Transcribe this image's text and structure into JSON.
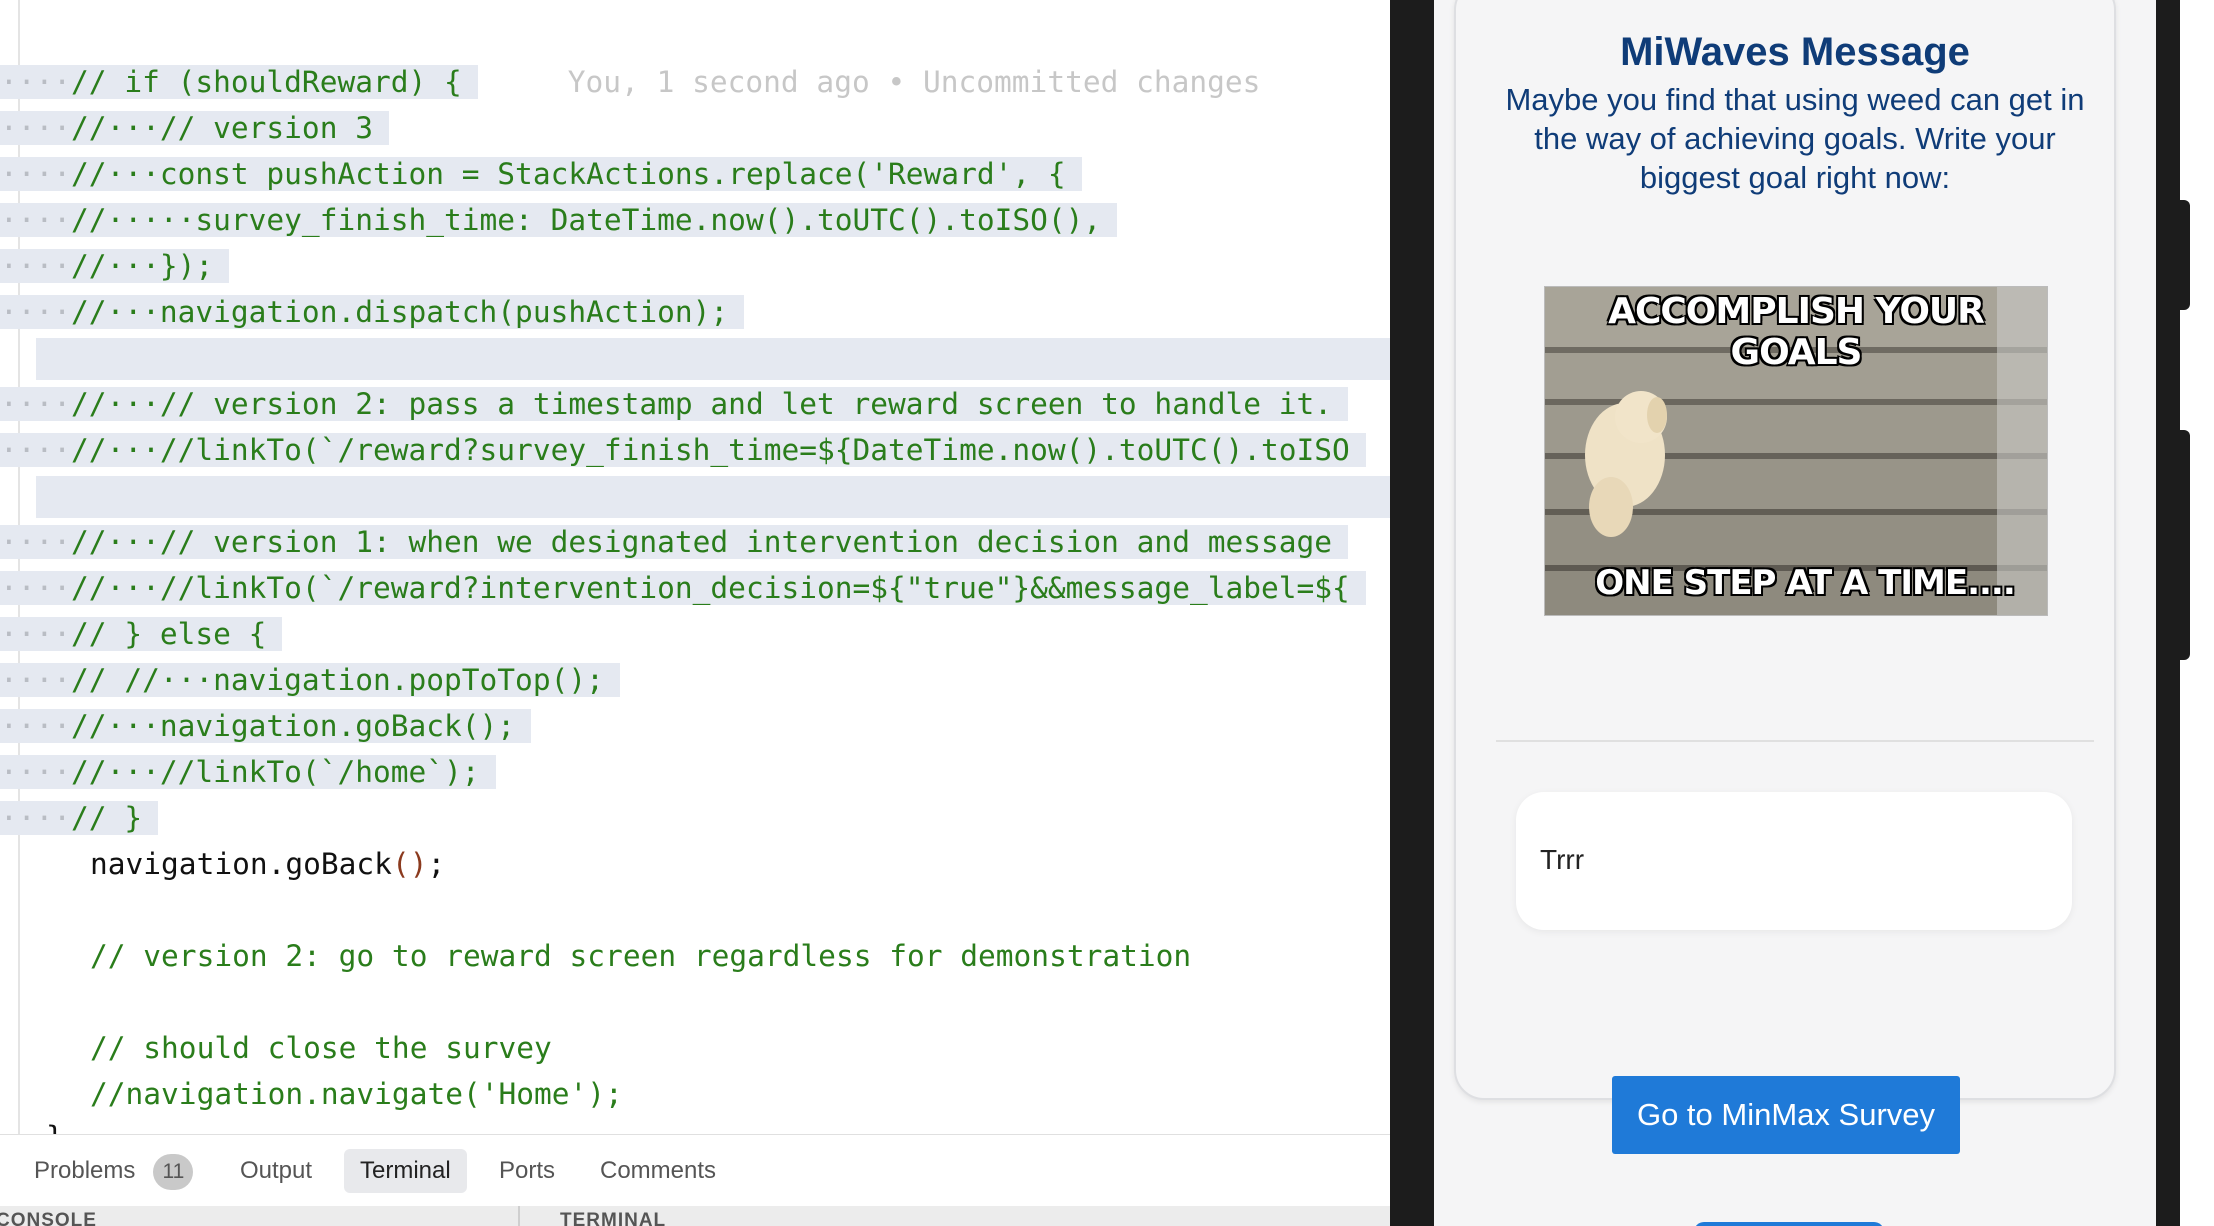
{
  "editor": {
    "lines": [
      {
        "ws": "····",
        "cm": "// if (shouldReward) {",
        "blame": "You, 1 second ago • Uncommitted changes"
      },
      {
        "ws": "····",
        "cm": "//···// version 3"
      },
      {
        "ws": "····",
        "cm": "//···const pushAction = StackActions.replace('Reward', {"
      },
      {
        "ws": "····",
        "cm": "//·····survey_finish_time: DateTime.now().toUTC().toISO(),"
      },
      {
        "ws": "····",
        "cm": "//···});"
      },
      {
        "ws": "····",
        "cm": "//···navigation.dispatch(pushAction);"
      },
      {
        "ws": "····",
        "cm": "//···// version 2: pass a timestamp and let reward screen to handle it."
      },
      {
        "ws": "····",
        "cm": "//···//linkTo(`/reward?survey_finish_time=${DateTime.now().toUTC().toISO"
      },
      {
        "ws": "····",
        "cm": "//···// version 1: when we designated intervention decision and message"
      },
      {
        "ws": "····",
        "cm": "//···//linkTo(`/reward?intervention_decision=${\"true\"}&&message_label=${"
      },
      {
        "ws": "····",
        "cm": "// } else {"
      },
      {
        "ws": "····",
        "cm": "// //···navigation.popToTop();"
      },
      {
        "ws": "····",
        "cm": "//···navigation.goBack();"
      },
      {
        "ws": "····",
        "cm": "//···//linkTo(`/home`);"
      },
      {
        "ws": "····",
        "cm": "// }"
      }
    ],
    "plain_line": "navigation.goBack",
    "plain_parens": "()",
    "plain_semicolon": ";",
    "comment_a": "// version 2: go to reward screen regardless for demonstration",
    "comment_b": "// should close the survey",
    "comment_c": "//navigation.navigate('Home');"
  },
  "panel": {
    "tabs": [
      {
        "label": "Problems",
        "badge": "11"
      },
      {
        "label": "Output"
      },
      {
        "label": "Terminal",
        "active": true
      },
      {
        "label": "Ports"
      },
      {
        "label": "Comments"
      }
    ],
    "left_section": "CONSOLE",
    "right_section": "TERMINAL"
  },
  "phone": {
    "title": "MiWaves Message",
    "body": "Maybe you find that using weed can get in the way of achieving goals. Write your biggest goal right now:",
    "meme_top": "ACCOMPLISH YOUR GOALS",
    "meme_bottom": "ONE STEP AT A TIME....",
    "answer": "Trrr",
    "button": "Go to MinMax Survey"
  },
  "colors": {
    "comment": "#2a7d1b",
    "selection": "#e5e9f1",
    "phone_title": "#0f3c78",
    "button": "#1f7ad8"
  }
}
